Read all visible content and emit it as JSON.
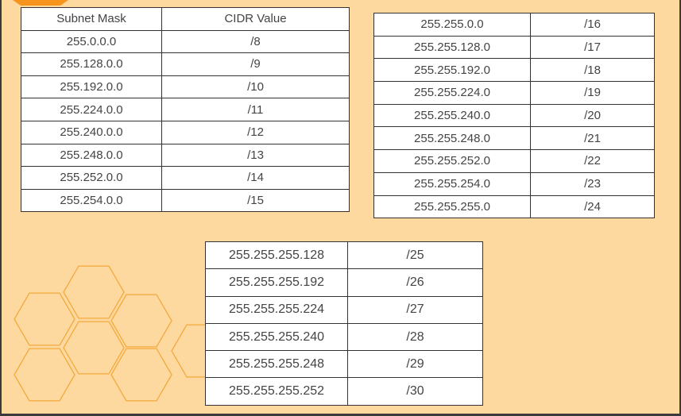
{
  "colors": {
    "background": "#fdd9a0",
    "hexagon_stroke": "#f3a93b",
    "corner_accent": "#f7941d",
    "table_border": "#333333",
    "table_fill": "#ffffff"
  },
  "table1": {
    "headers": [
      "Subnet Mask",
      "CIDR Value"
    ],
    "rows": [
      [
        "255.0.0.0",
        "/8"
      ],
      [
        "255.128.0.0",
        "/9"
      ],
      [
        "255.192.0.0",
        "/10"
      ],
      [
        "255.224.0.0",
        "/11"
      ],
      [
        "255.240.0.0",
        "/12"
      ],
      [
        "255.248.0.0",
        "/13"
      ],
      [
        "255.252.0.0",
        "/14"
      ],
      [
        "255.254.0.0",
        "/15"
      ]
    ]
  },
  "table2": {
    "rows": [
      [
        "255.255.0.0",
        "/16"
      ],
      [
        "255.255.128.0",
        "/17"
      ],
      [
        "255.255.192.0",
        "/18"
      ],
      [
        "255.255.224.0",
        "/19"
      ],
      [
        "255.255.240.0",
        "/20"
      ],
      [
        "255.255.248.0",
        "/21"
      ],
      [
        "255.255.252.0",
        "/22"
      ],
      [
        "255.255.254.0",
        "/23"
      ],
      [
        "255.255.255.0",
        "/24"
      ]
    ]
  },
  "table3": {
    "rows": [
      [
        "255.255.255.128",
        "/25"
      ],
      [
        "255.255.255.192",
        "/26"
      ],
      [
        "255.255.255.224",
        "/27"
      ],
      [
        "255.255.255.240",
        "/28"
      ],
      [
        "255.255.255.248",
        "/29"
      ],
      [
        "255.255.255.252",
        "/30"
      ]
    ]
  }
}
